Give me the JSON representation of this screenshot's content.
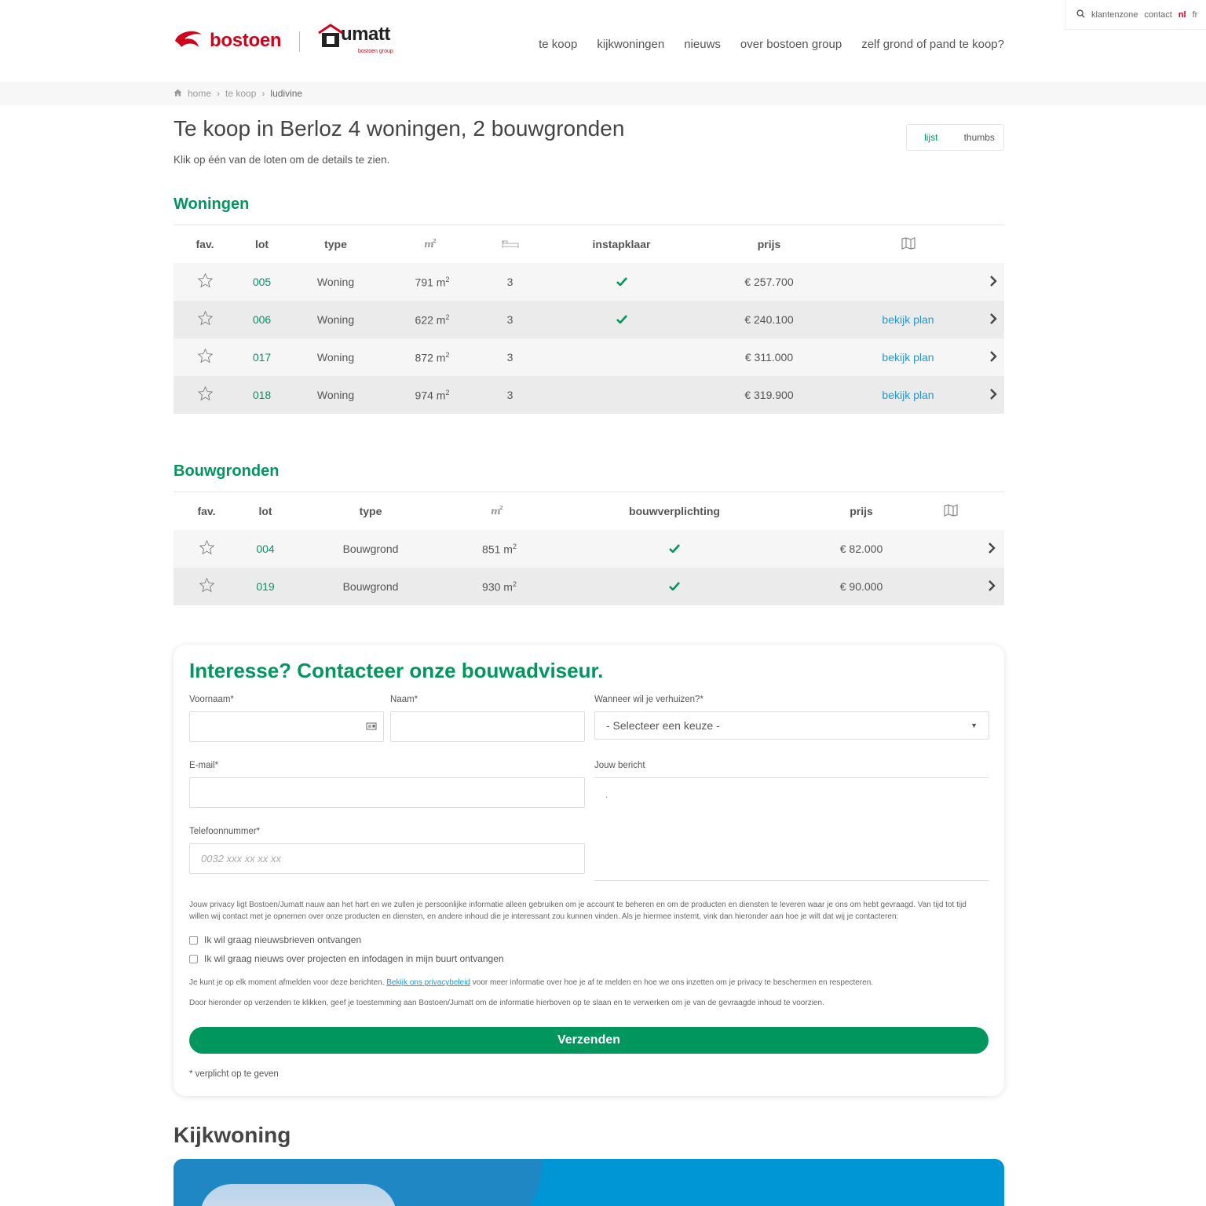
{
  "utility": {
    "items": [
      "klantenzone",
      "contact"
    ],
    "lang_nl": "nl",
    "lang_fr": "fr"
  },
  "header": {
    "logo_bostoen": "bostoen",
    "logo_jumatt": "umatt",
    "logo_jumatt_sub": "bostoen group",
    "nav": [
      "te koop",
      "kijkwoningen",
      "nieuws",
      "over bostoen group",
      "zelf grond of pand te koop?"
    ]
  },
  "breadcrumb": {
    "home": "home",
    "te_koop": "te koop",
    "current": "ludivine"
  },
  "page": {
    "title": "Te koop in Berloz 4 woningen, 2 bouwgronden",
    "subtitle": "Klik op één van de loten om de details te zien.",
    "view_list": "lijst",
    "view_thumbs": "thumbs"
  },
  "woningen": {
    "title": "Woningen",
    "headers": {
      "fav": "fav.",
      "lot": "lot",
      "type": "type",
      "area": "m²",
      "beds": "bed",
      "ready": "instapklaar",
      "price": "prijs",
      "plan": "plan"
    },
    "rows": [
      {
        "lot": "005",
        "type": "Woning",
        "area": "791 m",
        "beds": "3",
        "ready": true,
        "price": "€ 257.700",
        "plan": ""
      },
      {
        "lot": "006",
        "type": "Woning",
        "area": "622 m",
        "beds": "3",
        "ready": true,
        "price": "€ 240.100",
        "plan": "bekijk plan"
      },
      {
        "lot": "017",
        "type": "Woning",
        "area": "872 m",
        "beds": "3",
        "ready": false,
        "price": "€ 311.000",
        "plan": "bekijk plan"
      },
      {
        "lot": "018",
        "type": "Woning",
        "area": "974 m",
        "beds": "3",
        "ready": false,
        "price": "€ 319.900",
        "plan": "bekijk plan"
      }
    ]
  },
  "bouwgronden": {
    "title": "Bouwgronden",
    "headers": {
      "fav": "fav.",
      "lot": "lot",
      "type": "type",
      "area": "m²",
      "obligation": "bouwverplichting",
      "price": "prijs"
    },
    "rows": [
      {
        "lot": "004",
        "type": "Bouwgrond",
        "area": "851 m",
        "obligation": true,
        "price": "€ 82.000"
      },
      {
        "lot": "019",
        "type": "Bouwgrond",
        "area": "930 m",
        "obligation": true,
        "price": "€ 90.000"
      }
    ]
  },
  "form": {
    "title": "Interesse? Contacteer onze bouwadviseur.",
    "voornaam_label": "Voornaam*",
    "naam_label": "Naam*",
    "verhuizen_label": "Wanneer wil je verhuizen?*",
    "verhuizen_value": "- Selecteer een keuze -",
    "email_label": "E-mail*",
    "bericht_label": "Jouw bericht",
    "bericht_value": ".",
    "telefoon_label": "Telefoonnummer*",
    "telefoon_placeholder": "0032 xxx xx xx xx",
    "privacy_text": "Jouw privacy ligt Bostoen/Jumatt nauw aan het hart en we zullen je persoonlijke informatie alleen gebruiken om je account te beheren en om de producten en diensten te leveren waar je ons om hebt gevraagd. Van tijd tot tijd willen wij contact met je opnemen over onze producten en diensten, en andere inhoud die je interessant zou kunnen vinden. Als je hiermee instemt, vink dan hieronder aan hoe je wilt dat wij je contacteren:",
    "check_newsletter": "Ik wil graag nieuwsbrieven ontvangen",
    "check_news_projects": "Ik wil graag nieuws over projecten en infodagen in mijn buurt ontvangen",
    "unsubscribe_before": "Je kunt je op elk moment afmelden voor deze berichten.",
    "privacy_link": "Bekijk ons privacybeleid",
    "unsubscribe_after": "voor meer informatie over hoe je af te melden en hoe we ons inzetten om je privacy te beschermen en respecteren.",
    "consent_text": "Door hieronder op verzenden te klikken, geef je toestemming aan Bostoen/Jumatt om de informatie hierboven op te slaan en te verwerken om je van de gevraagde inhoud te voorzien.",
    "submit": "Verzenden",
    "required_note": "* verplicht op te geven"
  },
  "kijkwoning": {
    "title": "Kijkwoning"
  },
  "colors": {
    "brand_green": "#00965e",
    "brand_red": "#d0021b",
    "link_blue": "#1a9bd7",
    "banner_blue": "#0096d6"
  },
  "icons": [
    "search-icon",
    "home-icon",
    "star-icon",
    "check-icon",
    "chevron-right-icon",
    "map-icon",
    "bed-icon",
    "area-icon",
    "contact-card-icon"
  ]
}
